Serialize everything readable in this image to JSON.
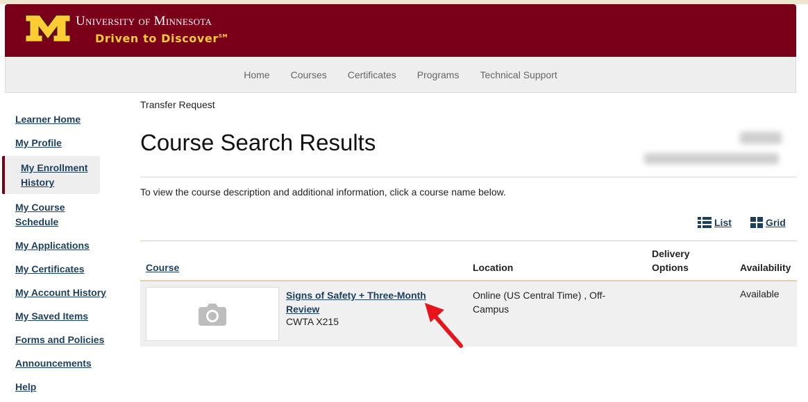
{
  "header": {
    "university_name": "University of Minnesota",
    "tagline": "Driven to Discover",
    "tagline_mark": "SM"
  },
  "topnav": {
    "items": [
      "Home",
      "Courses",
      "Certificates",
      "Programs",
      "Technical Support"
    ]
  },
  "sidebar": {
    "items": [
      "Learner Home",
      "My Profile",
      "My Enrollment History",
      "My Course Schedule",
      "My Applications",
      "My Certificates",
      "My Account History",
      "My Saved Items",
      "Forms and Policies",
      "Announcements",
      "Help"
    ],
    "active": "My Enrollment History"
  },
  "main": {
    "breadcrumb": "Transfer Request",
    "title": "Course Search Results",
    "instructions": "To view the course description and additional information, click a course name below.",
    "view_list_label": "List",
    "view_grid_label": "Grid"
  },
  "table": {
    "headers": {
      "course": "Course",
      "location": "Location",
      "delivery": "Delivery Options",
      "availability": "Availability"
    },
    "rows": [
      {
        "course_name": "Signs of Safety + Three-Month Review",
        "course_code": "CWTA X215",
        "location": "Online (US Central Time) , Off-Campus",
        "delivery": "",
        "availability": "Available",
        "thumbnail_icon": "camera-icon"
      }
    ]
  },
  "annotation": {
    "arrow_color": "#e8141c"
  },
  "colors": {
    "maroon": "#7a0019",
    "gold": "#ffcc33",
    "link": "#1c3f5e"
  }
}
